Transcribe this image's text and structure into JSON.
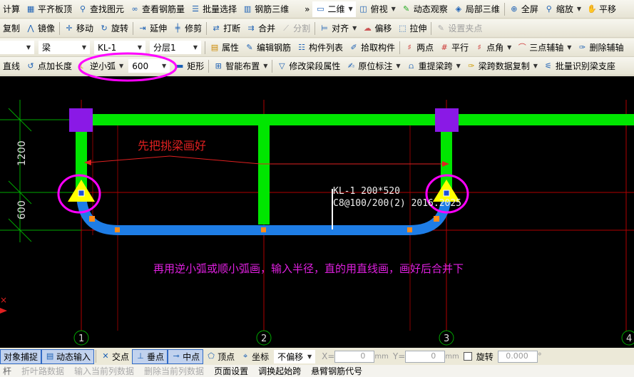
{
  "toolbar1": [
    "计算",
    "平齐板顶",
    "查找图元",
    "查看钢筋量",
    "批量选择",
    "钢筋三维",
    "»",
    "二维",
    "俯视",
    "动态观察",
    "局部三维",
    "全屏",
    "缩放",
    "平移"
  ],
  "toolbar2": [
    "复制",
    "镜像",
    "移动",
    "旋转",
    "延伸",
    "修剪",
    "打断",
    "合并",
    "分割",
    "对齐",
    "偏移",
    "拉伸",
    "设置夹点"
  ],
  "toolbar3": {
    "combo_type": "梁",
    "combo_name": "KL-1",
    "combo_layer": "分层1",
    "items": [
      "属性",
      "编辑钢筋",
      "构件列表",
      "拾取构件",
      "两点",
      "平行",
      "点角",
      "三点辅轴",
      "删除辅轴"
    ]
  },
  "toolbar4": {
    "items": [
      "直线",
      "点加长度",
      "逆小弧"
    ],
    "radius": "600",
    "items2": [
      "矩形",
      "智能布置",
      "修改梁段属性",
      "原位标注",
      "重提梁跨",
      "梁跨数据复制",
      "批量识别梁支座"
    ]
  },
  "canvas": {
    "note1": "先把挑梁画好",
    "note2": "再用逆小弧或顺小弧画，输入半径，直的用直线画，画好后合并下",
    "beam_label1": "KL-1 200*520",
    "beam_label2": "C8@100/200(2)  2016.2025",
    "dim1": "1200",
    "dim2": "600",
    "axes": [
      "1",
      "2",
      "3",
      "4"
    ],
    "colors": {
      "beam": "#00e600",
      "arc_beam": "#1e7de6",
      "column": "#8a19e6",
      "support": "#ffff00",
      "highlight": "#ff00ff",
      "grid": "#c00000"
    }
  },
  "status": {
    "items": [
      "对象捕捉",
      "动态输入",
      "交点",
      "垂点",
      "中点",
      "顶点",
      "坐标"
    ],
    "offset": "不偏移",
    "x_label": "X=",
    "x": "0",
    "y_label": "Y=",
    "y": "0",
    "unit": "mm",
    "rotate": "旋转",
    "angle": "0.000",
    "deg": "°"
  },
  "bottom": [
    "杆",
    "折叶路数据",
    "输入当前列数据",
    "删除当前列数据",
    "页面设置",
    "调换起始跨",
    "悬臂钢筋代号"
  ]
}
